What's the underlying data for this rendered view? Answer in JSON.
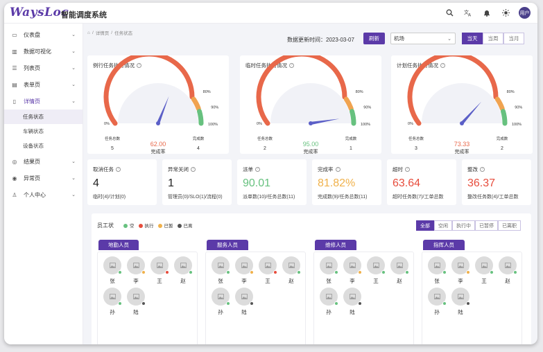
{
  "header": {
    "logo": "WaysLoc",
    "title": "智能调度系统",
    "avatar_text": "用户"
  },
  "sidebar": {
    "items": [
      {
        "label": "仪表盘",
        "icon": "monitor-icon",
        "glyph": "▭"
      },
      {
        "label": "数据可视化",
        "icon": "chart-icon",
        "glyph": "▥"
      },
      {
        "label": "列表页",
        "icon": "list-icon",
        "glyph": "☰"
      },
      {
        "label": "表单页",
        "icon": "form-icon",
        "glyph": "▤"
      },
      {
        "label": "详情页",
        "icon": "file-icon",
        "glyph": "▯"
      },
      {
        "label": "结果页",
        "icon": "check-circle-icon",
        "glyph": "◎"
      },
      {
        "label": "异常页",
        "icon": "warning-circle-icon",
        "glyph": "◉"
      },
      {
        "label": "个人中心",
        "icon": "user-icon",
        "glyph": "♙"
      }
    ],
    "sub_items": [
      "任务状态",
      "车辆状态",
      "设备状态"
    ]
  },
  "breadcrumb": {
    "home": "⌂",
    "sep": "/",
    "level1": "详情页",
    "level2": "任务状态"
  },
  "toolbar": {
    "update_label": "数据更新时间：2023-03-07",
    "refresh_label": "刷新",
    "select_value": "机场",
    "ranges": [
      "当天",
      "当周",
      "当月"
    ]
  },
  "gauges": [
    {
      "title": "例行任务执行情况",
      "value": "62.00",
      "rate_label": "完成率",
      "left_label": "任务总数",
      "left_value": "5",
      "right_label": "完成数",
      "right_value": "4",
      "value_color": "#e8684a"
    },
    {
      "title": "临时任务执行情况",
      "value": "95.00",
      "rate_label": "完成率",
      "left_label": "任务总数",
      "left_value": "2",
      "right_label": "完成数",
      "right_value": "1",
      "value_color": "#67c17f"
    },
    {
      "title": "计划任务执行情况",
      "value": "73.33",
      "rate_label": "完成率",
      "left_label": "任务总数",
      "left_value": "3",
      "right_label": "完成数",
      "right_value": "2",
      "value_color": "#e8684a"
    }
  ],
  "gauge_scale": {
    "min": "0%",
    "p80": "80%",
    "p90": "90%",
    "max": "100%"
  },
  "gauge_colors": {
    "red": "#e8684a",
    "orange": "#f0a350",
    "green": "#67c17f",
    "needle": "#5b5fc7",
    "track": "#f1f2f7"
  },
  "stats": [
    {
      "title": "取消任务",
      "value": "4",
      "sub": "临时(4)/计划(0)",
      "color": "#222"
    },
    {
      "title": "异常关闭",
      "value": "1",
      "sub": "管理员(0)/SLO(1)/流程(0)",
      "color": "#222"
    },
    {
      "title": "派单",
      "value": "90.01",
      "sub": "派单数(10)/任务总数(11)",
      "color": "#67c17f"
    },
    {
      "title": "完成率",
      "value": "81.82%",
      "sub": "完成数(9)/任务总数(11)",
      "color": "#f0b14a"
    },
    {
      "title": "超时",
      "value": "63.64",
      "sub": "超时任务数(7)/工单总数",
      "color": "#e74c3c"
    },
    {
      "title": "整改",
      "value": "36.37",
      "sub": "整改任务数(4)/工单总数",
      "color": "#e74c3c"
    }
  ],
  "staff": {
    "title": "员工状",
    "legend": [
      {
        "label": "空",
        "color": "#67c17f"
      },
      {
        "label": "执行",
        "color": "#e74c3c"
      },
      {
        "label": "已暂",
        "color": "#f0b14a"
      },
      {
        "label": "已离",
        "color": "#555555"
      }
    ],
    "filters": [
      "全部",
      "空闲",
      "执行中",
      "已暂停",
      "已离职"
    ],
    "groups": [
      {
        "name": "地勤人员",
        "people": [
          {
            "name": "张",
            "status": "#67c17f"
          },
          {
            "name": "李",
            "status": "#f0b14a"
          },
          {
            "name": "王",
            "status": "#e74c3c"
          },
          {
            "name": "赵",
            "status": "#67c17f"
          },
          {
            "name": "孙",
            "status": "#67c17f"
          },
          {
            "name": "陆",
            "status": "#555555"
          }
        ]
      },
      {
        "name": "服务人员",
        "people": [
          {
            "name": "张",
            "status": "#67c17f"
          },
          {
            "name": "李",
            "status": "#f0b14a"
          },
          {
            "name": "王",
            "status": "#e74c3c"
          },
          {
            "name": "赵",
            "status": "#67c17f"
          },
          {
            "name": "孙",
            "status": "#67c17f"
          },
          {
            "name": "陆",
            "status": "#555555"
          }
        ]
      },
      {
        "name": "维修人员",
        "people": [
          {
            "name": "张",
            "status": "#67c17f"
          },
          {
            "name": "李",
            "status": "#f0b14a"
          },
          {
            "name": "王",
            "status": "#67c17f"
          },
          {
            "name": "赵",
            "status": "#67c17f"
          },
          {
            "name": "孙",
            "status": "#67c17f"
          },
          {
            "name": "陆",
            "status": "#555555"
          }
        ]
      },
      {
        "name": "指挥人员",
        "people": [
          {
            "name": "张",
            "status": "#67c17f"
          },
          {
            "name": "李",
            "status": "#f0b14a"
          },
          {
            "name": "王",
            "status": "#67c17f"
          },
          {
            "name": "赵",
            "status": "#67c17f"
          },
          {
            "name": "孙",
            "status": "#67c17f"
          },
          {
            "name": "陆",
            "status": "#555555"
          }
        ]
      }
    ]
  }
}
